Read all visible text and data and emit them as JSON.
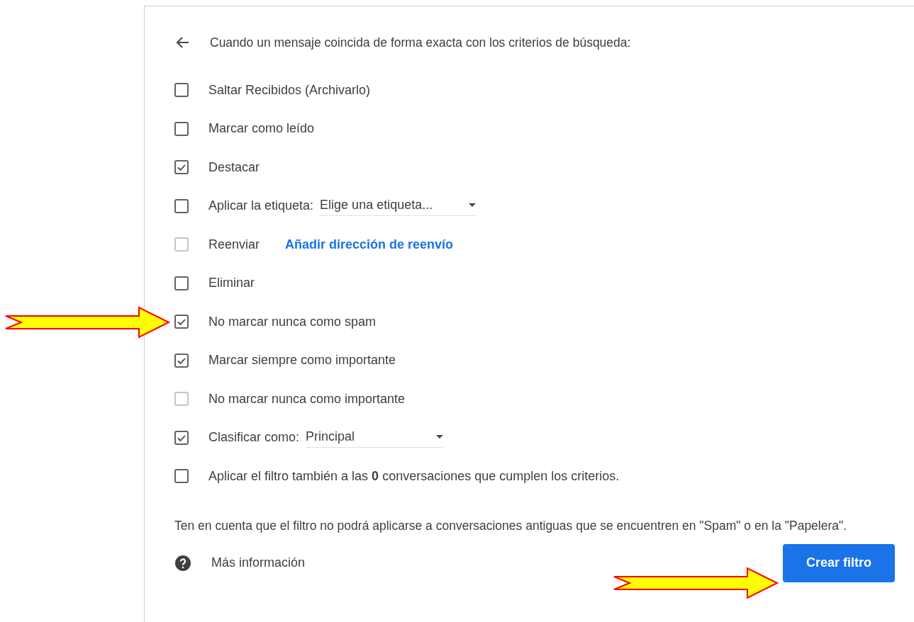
{
  "header": {
    "title": "Cuando un mensaje coincida de forma exacta con los criterios de búsqueda:"
  },
  "options": [
    {
      "kind": "plain",
      "label": "Saltar Recibidos (Archivarlo)",
      "checked": false,
      "disabled": false
    },
    {
      "kind": "plain",
      "label": "Marcar como leído",
      "checked": false,
      "disabled": false
    },
    {
      "kind": "plain",
      "label": "Destacar",
      "checked": true,
      "disabled": false
    },
    {
      "kind": "select",
      "label": "Aplicar la etiqueta:",
      "value": "Elige una etiqueta...",
      "checked": false,
      "disabled": false
    },
    {
      "kind": "link",
      "label": "Reenviar",
      "link": "Añadir dirección de reenvío",
      "checked": false,
      "disabled": true
    },
    {
      "kind": "plain",
      "label": "Eliminar",
      "checked": false,
      "disabled": false
    },
    {
      "kind": "plain",
      "label": "No marcar nunca como spam",
      "checked": true,
      "disabled": false
    },
    {
      "kind": "plain",
      "label": "Marcar siempre como importante",
      "checked": true,
      "disabled": false
    },
    {
      "kind": "plain",
      "label": "No marcar nunca como importante",
      "checked": false,
      "disabled": true
    },
    {
      "kind": "select",
      "label": "Clasificar como:",
      "value": "Principal",
      "checked": true,
      "disabled": false
    },
    {
      "kind": "plain",
      "label": "Aplicar el filtro también a las **0** conversaciones que cumplen los criterios.",
      "checked": false,
      "disabled": false
    }
  ],
  "note": "Ten en cuenta que el filtro no podrá aplicarse a conversaciones antiguas que se encuentren en \"Spam\" o en la \"Papelera\".",
  "help_link": "Más información",
  "create_button": "Crear filtro"
}
